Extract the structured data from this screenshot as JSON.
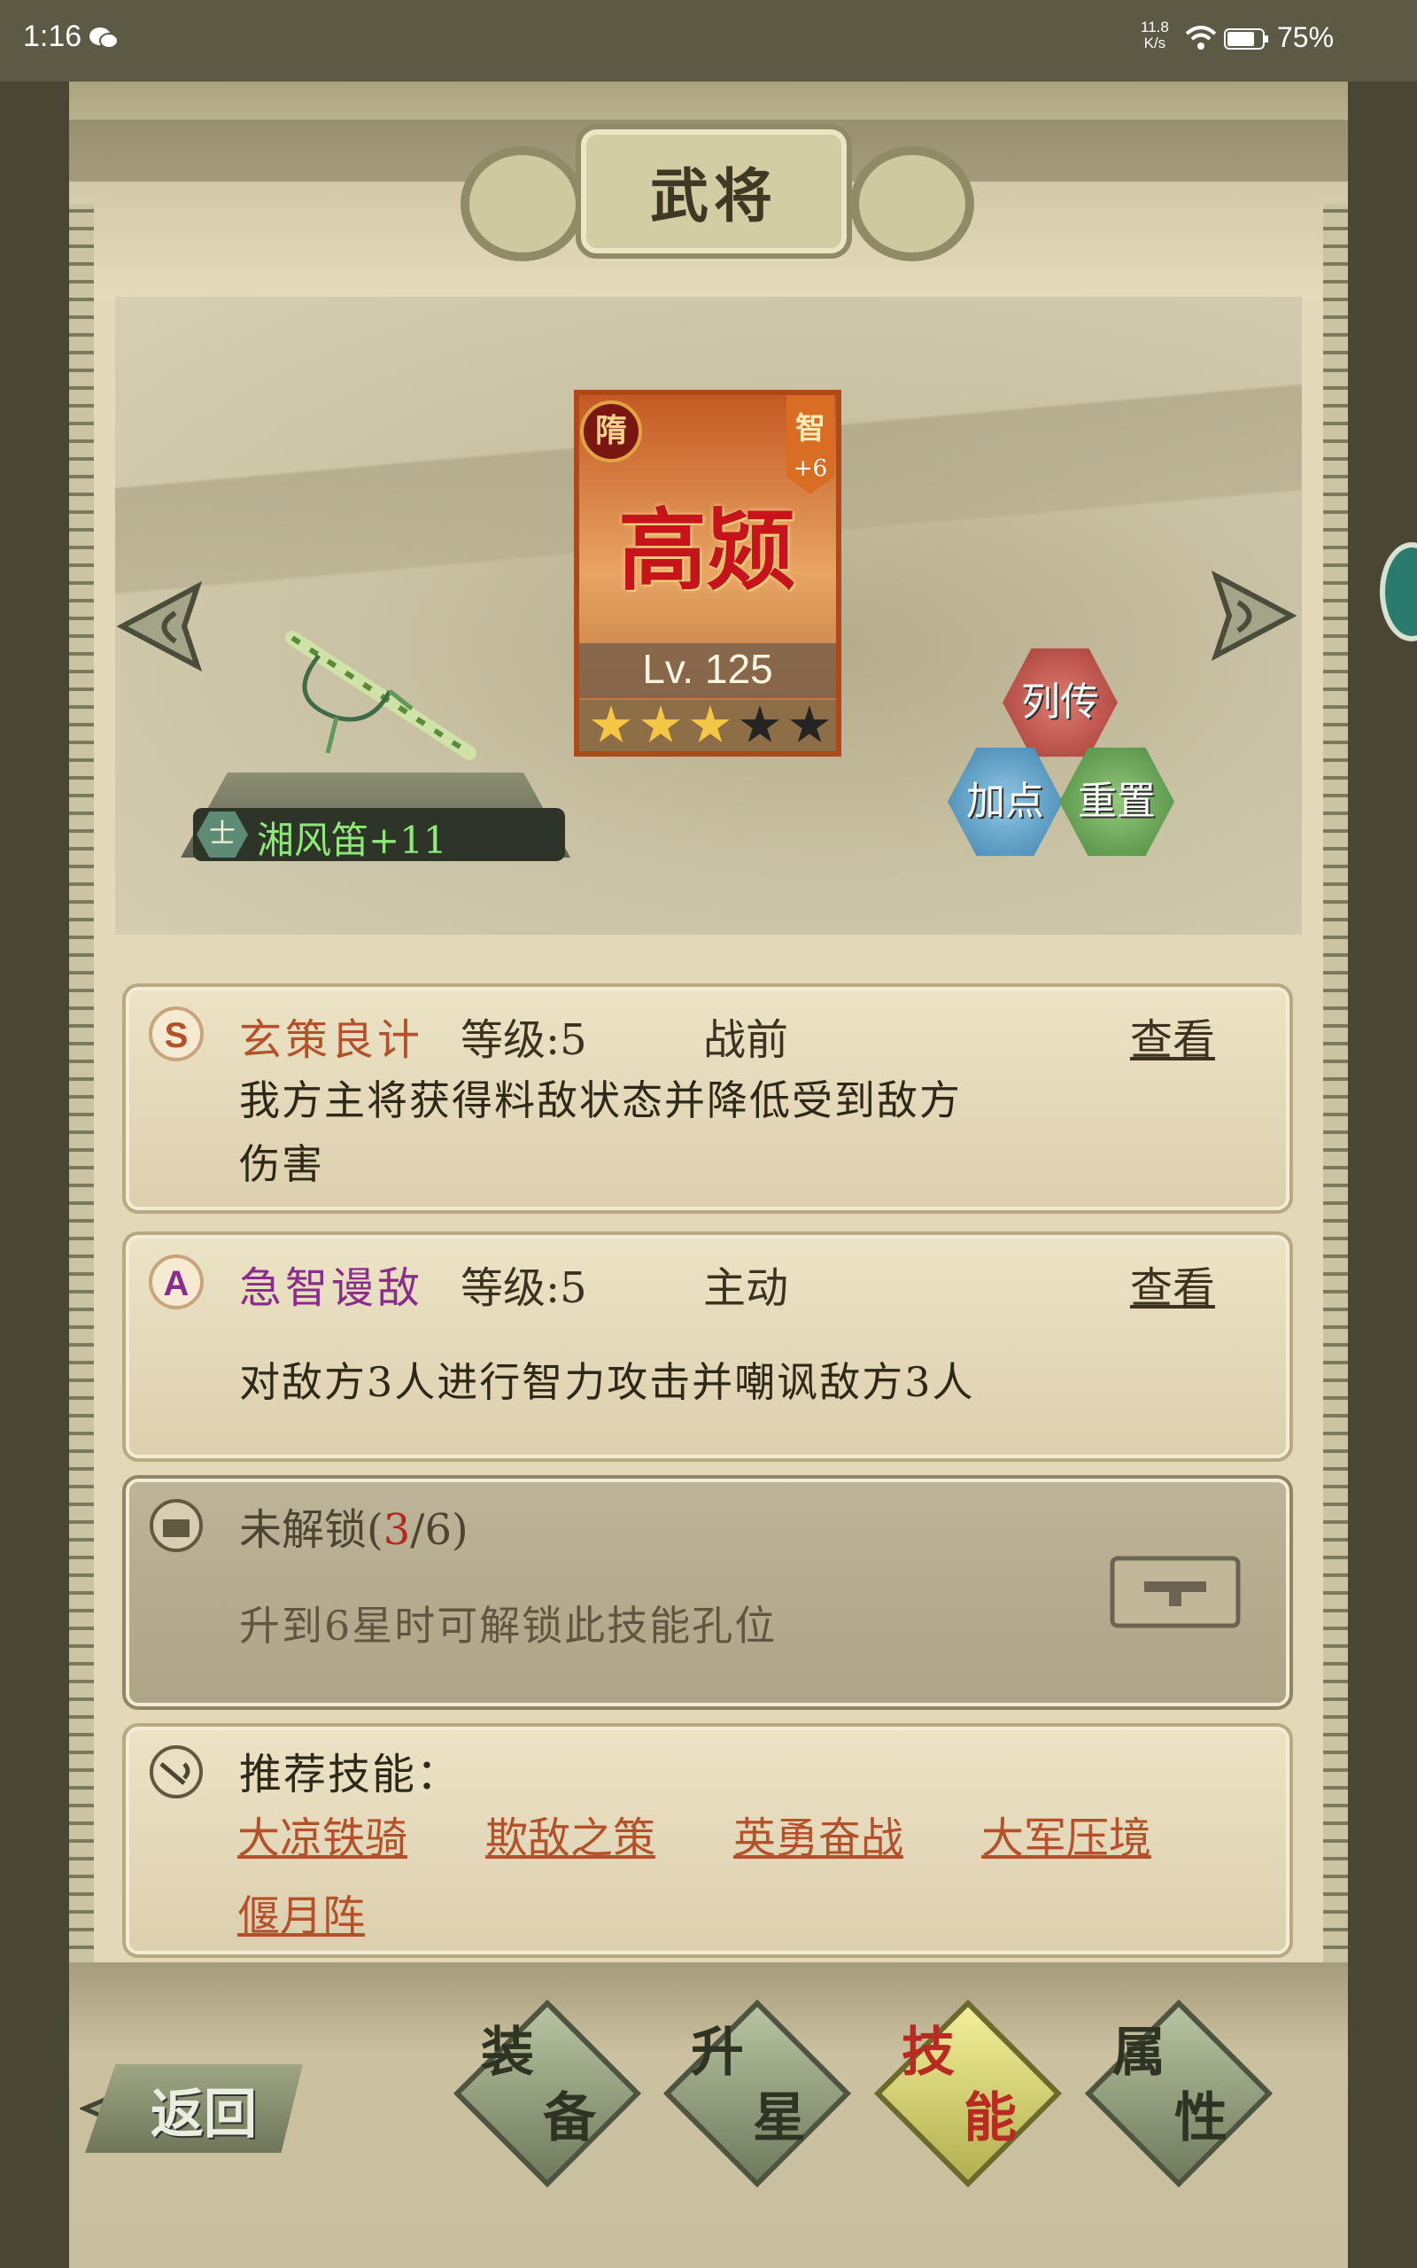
{
  "status_bar": {
    "time": "1:16",
    "net_speed_value": "11.8",
    "net_speed_unit": "K/s",
    "battery": "75%"
  },
  "header": {
    "title": "武将"
  },
  "hero": {
    "dynasty": "隋",
    "class": "智",
    "class_bonus": "+6",
    "name": "高颎",
    "level": "Lv. 125",
    "stars_filled": 3,
    "stars_total": 5
  },
  "weapon": {
    "class_icon": "士",
    "name": "湘风笛+11"
  },
  "hex_buttons": {
    "biography": "列传",
    "add_points": "加点",
    "reset": "重置"
  },
  "skills": [
    {
      "grade": "S",
      "name": "玄策良计",
      "level": "等级:5",
      "type": "战前",
      "view": "查看",
      "desc_line1": "我方主将获得料敌状态并降低受到敌方",
      "desc_line2": "伤害",
      "name_color": "#b4512a"
    },
    {
      "grade": "A",
      "name": "急智谩敌",
      "level": "等级:5",
      "type": "主动",
      "view": "查看",
      "desc_line1": "对敌方3人进行智力攻击并嘲讽敌方3人",
      "name_color": "#8b2c8c"
    }
  ],
  "locked_slot": {
    "label_prefix": "未解锁(",
    "count_current": "3",
    "count_rest": "/6)",
    "desc": "升到6星时可解锁此技能孔位"
  },
  "recommended": {
    "title": "推荐技能：",
    "skills": [
      "大凉铁骑",
      "欺敌之策",
      "英勇奋战",
      "大军压境",
      "偃月阵"
    ]
  },
  "bottom_nav": {
    "back": "返回",
    "tabs": [
      {
        "label1": "装",
        "label2": "备"
      },
      {
        "label1": "升",
        "label2": "星"
      },
      {
        "label1": "技",
        "label2": "能"
      },
      {
        "label1": "属",
        "label2": "性"
      }
    ],
    "active_tab": 2
  },
  "colors": {
    "skill_link": "#b4512a",
    "locked_count": "#b02a1f",
    "active_tab_text": "#b82a22"
  }
}
